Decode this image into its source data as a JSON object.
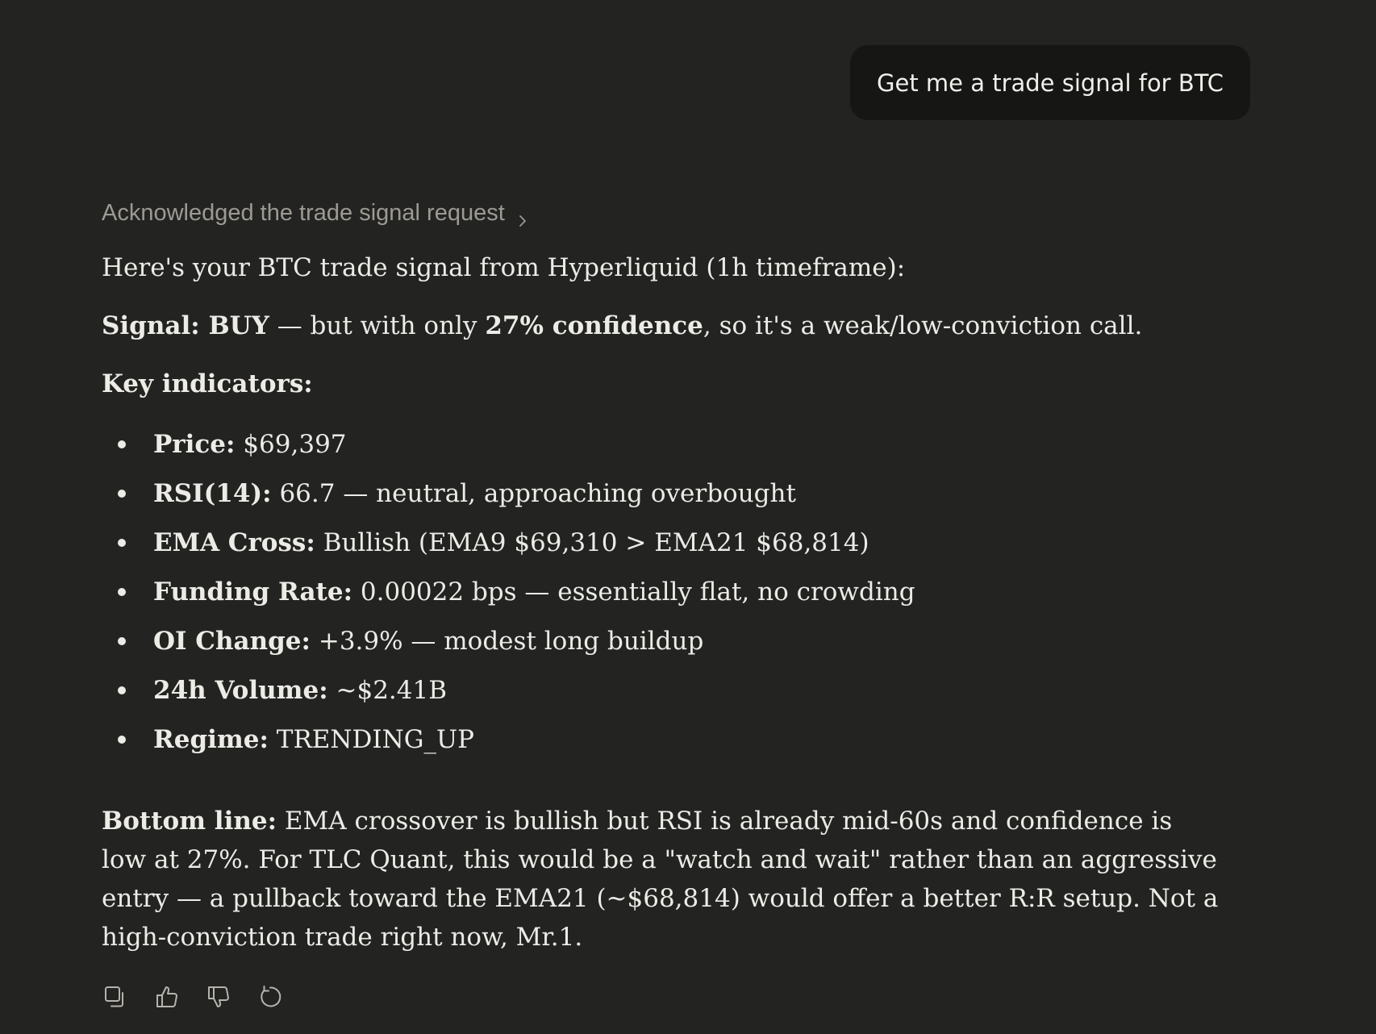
{
  "user_message": "Get me a trade signal for BTC",
  "thinking": {
    "label": "Acknowledged the trade signal request",
    "icon": "chevron-right-icon"
  },
  "response": {
    "intro": "Here's your BTC trade signal from Hyperliquid (1h timeframe):",
    "signal": {
      "label": "Signal: BUY",
      "mid": " — but with only ",
      "confidence": "27% confidence",
      "tail": ", so it's a weak/low-conviction call."
    },
    "indicators_heading": "Key indicators:",
    "indicators": [
      {
        "label": "Price:",
        "value": "$69,397"
      },
      {
        "label": "RSI(14):",
        "value": "66.7 — neutral, approaching overbought"
      },
      {
        "label": "EMA Cross:",
        "value": "Bullish (EMA9 $69,310 > EMA21 $68,814)"
      },
      {
        "label": "Funding Rate:",
        "value": "0.00022 bps — essentially flat, no crowding"
      },
      {
        "label": "OI Change:",
        "value": "+3.9% — modest long buildup"
      },
      {
        "label": "24h Volume:",
        "value": "~$2.41B"
      },
      {
        "label": "Regime:",
        "value": "TRENDING_UP"
      }
    ],
    "bottom_line": {
      "label": "Bottom line:",
      "text": "EMA crossover is bullish but RSI is already mid-60s and confidence is low at 27%. For TLC Quant, this would be a \"watch and wait\" rather than an aggressive entry — a pullback toward the EMA21 (~$68,814) would offer a better R:R setup. Not a high-conviction trade right now, Mr.1."
    }
  },
  "actions": [
    {
      "name": "copy-icon"
    },
    {
      "name": "thumbs-up-icon"
    },
    {
      "name": "thumbs-down-icon"
    },
    {
      "name": "retry-icon"
    }
  ],
  "colors": {
    "background": "#232322",
    "user_bubble": "#161615",
    "text": "#ecebe6",
    "muted": "#9c9a93"
  }
}
